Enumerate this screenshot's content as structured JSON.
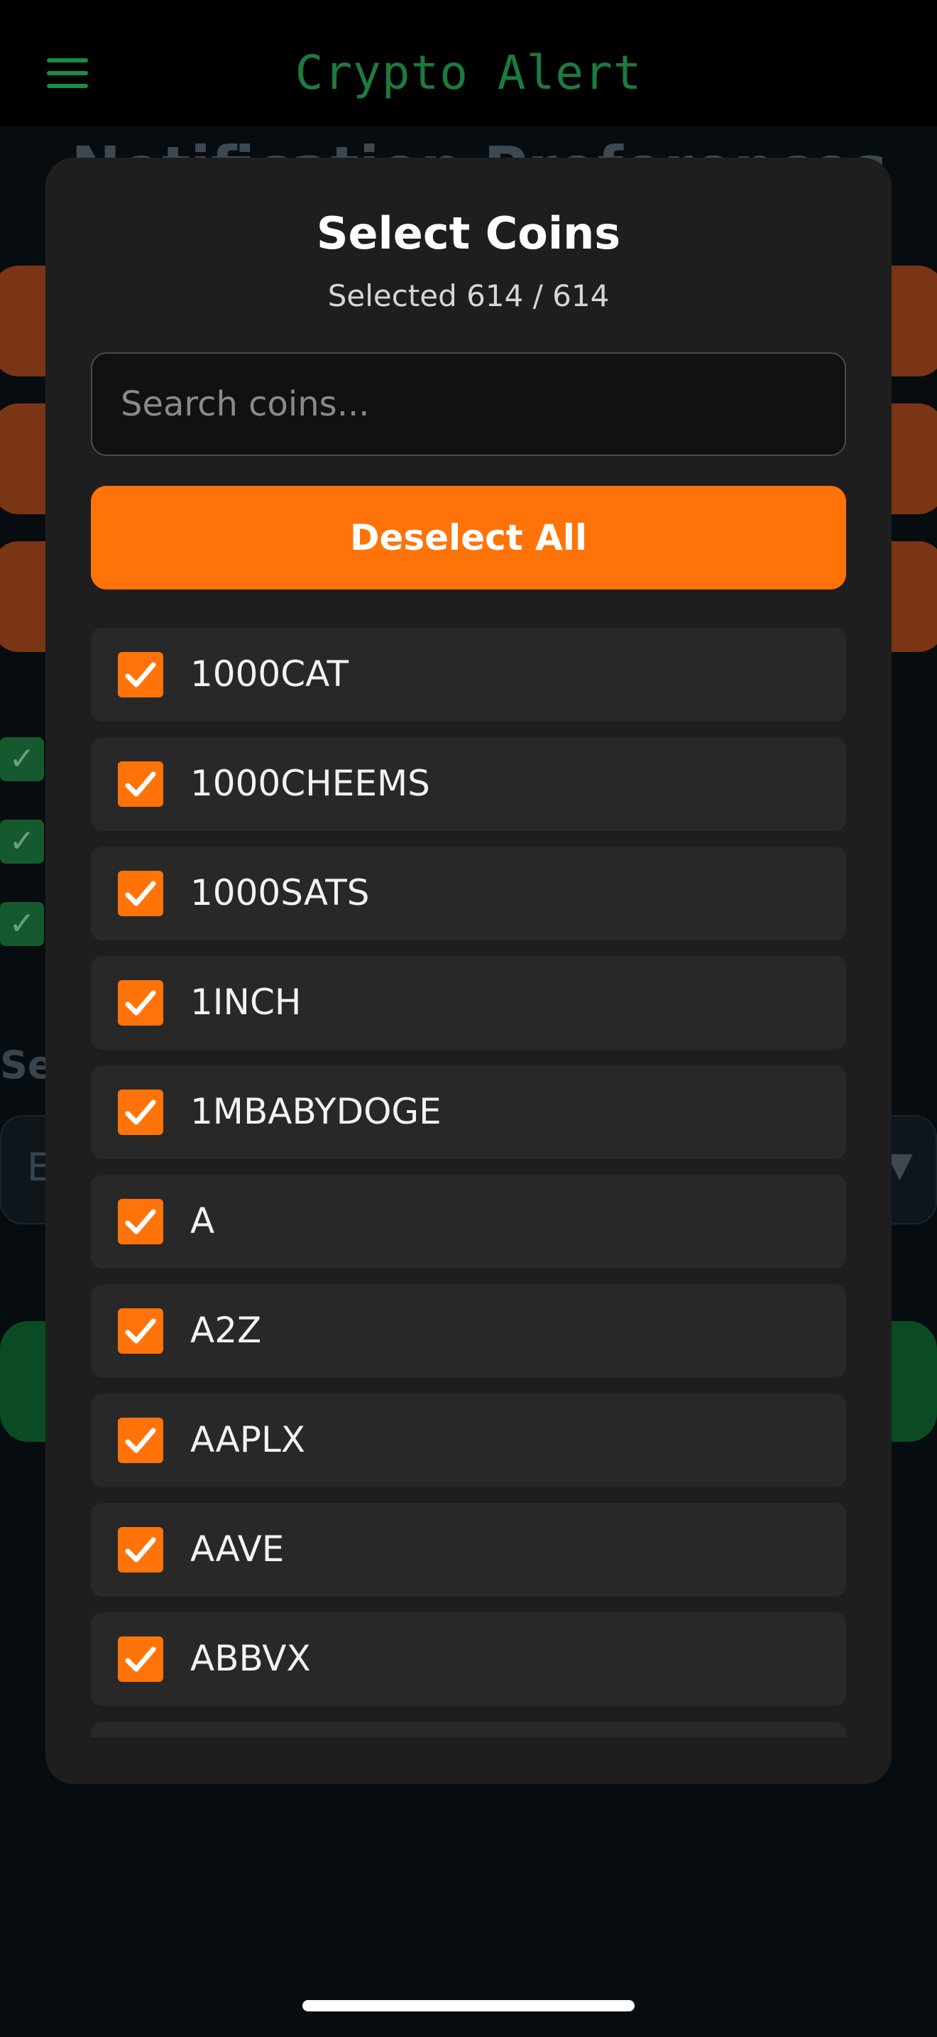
{
  "header": {
    "app_title": "Crypto Alert"
  },
  "background": {
    "heading": "Notification Preferences",
    "section_label": "Se",
    "select_value": "E",
    "select_arrow": "▼"
  },
  "modal": {
    "title": "Select Coins",
    "selected_text": "Selected 614 / 614",
    "search_placeholder": "Search coins...",
    "deselect_label": "Deselect All",
    "coins": [
      {
        "name": "1000CAT",
        "checked": true
      },
      {
        "name": "1000CHEEMS",
        "checked": true
      },
      {
        "name": "1000SATS",
        "checked": true
      },
      {
        "name": "1INCH",
        "checked": true
      },
      {
        "name": "1MBABYDOGE",
        "checked": true
      },
      {
        "name": "A",
        "checked": true
      },
      {
        "name": "A2Z",
        "checked": true
      },
      {
        "name": "AAPLX",
        "checked": true
      },
      {
        "name": "AAVE",
        "checked": true
      },
      {
        "name": "ABBVX",
        "checked": true
      }
    ]
  },
  "colors": {
    "accent_orange": "#ff7308",
    "brand_green": "#1d7a3f",
    "modal_bg": "#1e1e1e"
  }
}
